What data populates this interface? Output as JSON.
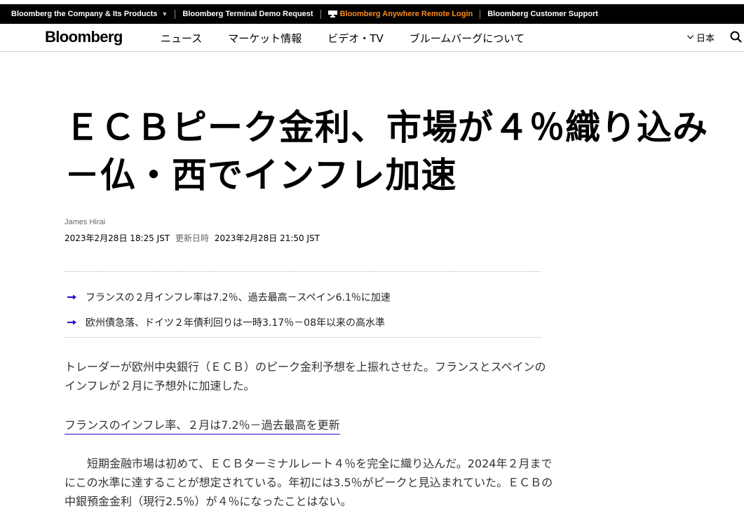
{
  "topbar": {
    "item1": "Bloomberg the Company & Its Products",
    "item2": "Bloomberg Terminal Demo Request",
    "item3": "Bloomberg Anywhere Remote Login",
    "item4": "Bloomberg Customer Support"
  },
  "nav": {
    "logo": "Bloomberg",
    "links": [
      "ニュース",
      "マーケット情報",
      "ビデオ・TV",
      "ブルームバーグについて"
    ],
    "language": "日本"
  },
  "article": {
    "headline": "ＥＣＢピーク金利、市場が４％織り込み－仏・西でインフレ加速",
    "author": "James Hirai",
    "published": "2023年2月28日 18:25 JST",
    "updated_label": "更新日時",
    "updated": "2023年2月28日 21:50 JST",
    "bullets": [
      "フランスの２月インフレ率は7.2％、過去最高－スペイン6.1％に加速",
      "欧州債急落、ドイツ２年債利回りは一時3.17％－08年以来の高水準"
    ],
    "para1": "トレーダーが欧州中央銀行（ＥＣＢ）のピーク金利予想を上振れさせた。フランスとスペインのインフレが２月に予想外に加速した。",
    "related_link": "フランスのインフレ率、２月は7.2％－過去最高を更新",
    "para2": "短期金融市場は初めて、ＥＣＢターミナルレート４％を完全に織り込んだ。2024年２月までにこの水準に達することが想定されている。年初には3.5％がピークと見込まれていた。ＥＣＢの中銀預金金利（現行2.5％）が４％になったことはない。"
  },
  "colors": {
    "accent": "#2800d7",
    "orange": "#fb8b1e"
  }
}
